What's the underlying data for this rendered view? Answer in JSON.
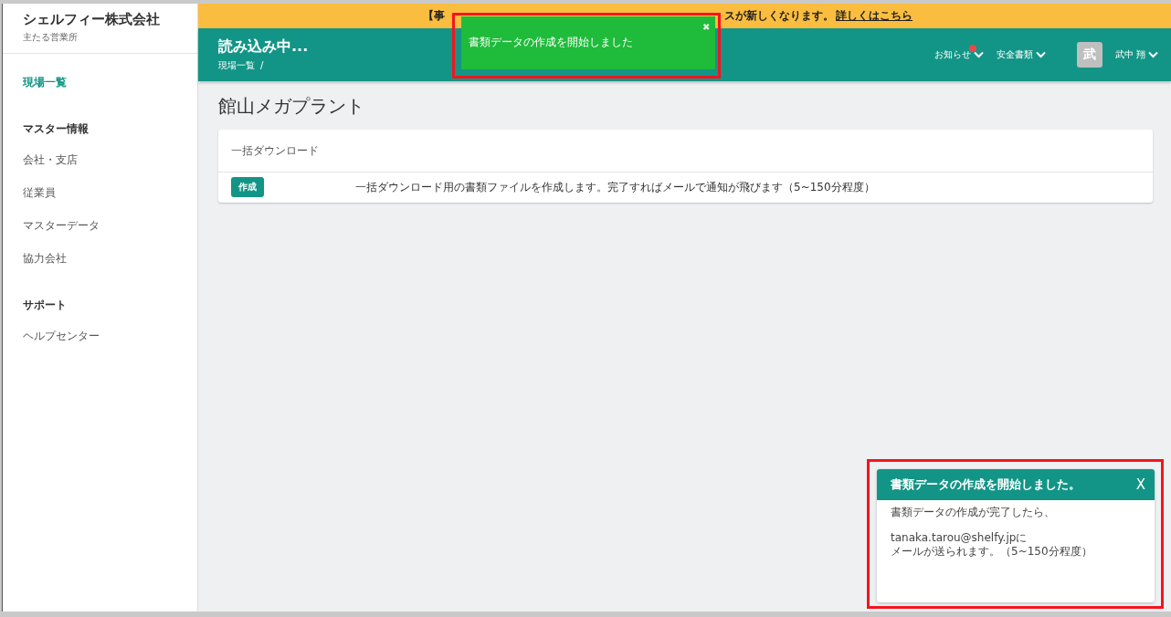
{
  "sidebar": {
    "company": "シェルフィー株式会社",
    "office": "主たる営業所",
    "sections": [
      {
        "items": [
          {
            "label": "現場一覧",
            "selected": true
          }
        ]
      },
      {
        "heading": "マスター情報",
        "items": [
          {
            "label": "会社・支店",
            "selected": false
          },
          {
            "label": "従業員",
            "selected": false
          },
          {
            "label": "マスターデータ",
            "selected": false
          },
          {
            "label": "協力会社",
            "selected": false
          }
        ]
      },
      {
        "heading": "サポート",
        "items": [
          {
            "label": "ヘルプセンター",
            "selected": false
          }
        ]
      }
    ]
  },
  "banner": {
    "text_before": "【事",
    "text_after": "スが新しくなります。",
    "link": "詳しくはこちら"
  },
  "header": {
    "title": "読み込み中...",
    "breadcrumb": "現場一覧",
    "separator": "/",
    "menus": [
      {
        "label": "お知らせ",
        "unread": true
      },
      {
        "label": "安全書類",
        "unread": false
      }
    ],
    "user": {
      "avatar": "武",
      "name": "武中 翔"
    }
  },
  "toast": {
    "message": "書類データの作成を開始しました",
    "close": "✖"
  },
  "page": {
    "title": "館山メガプラント",
    "card": {
      "heading": "一括ダウンロード",
      "button": "作成",
      "description": "一括ダウンロード用の書類ファイルを作成します。完了すればメールで通知が飛びます（5~150分程度）"
    }
  },
  "notification": {
    "title": "書類データの作成を開始しました。",
    "close": "X",
    "line1": "書類データの作成が完了したら、",
    "email": "tanaka.tarou@shelfy.jpに",
    "line2": "メールが送られます。（5~150分程度）"
  }
}
